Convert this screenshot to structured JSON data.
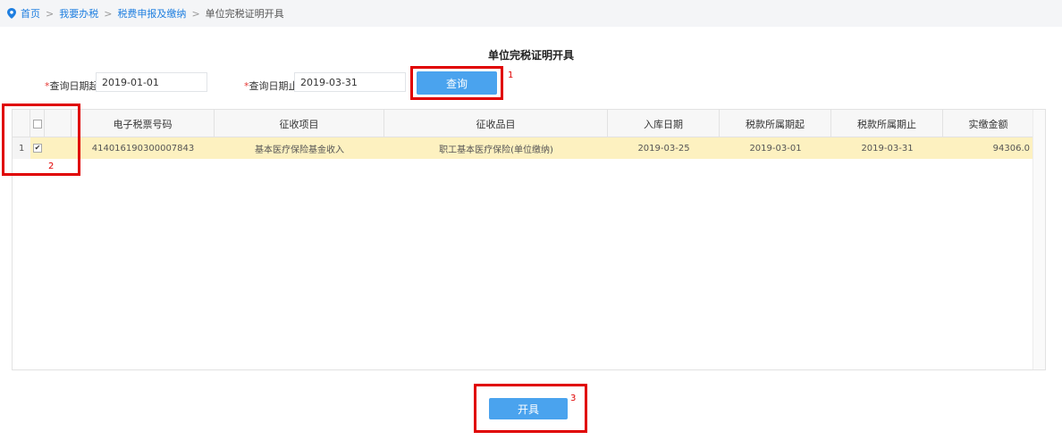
{
  "breadcrumb": {
    "items": [
      "首页",
      "我要办税",
      "税费申报及缴纳"
    ],
    "separator": ">",
    "current": "单位完税证明开具"
  },
  "page_title": "单位完税证明开具",
  "query": {
    "start_label": "查询日期起:",
    "start_value": "2019-01-01",
    "end_label": "查询日期止:",
    "end_value": "2019-03-31",
    "required_mark": "*",
    "button": "查询"
  },
  "table": {
    "columns": [
      "电子税票号码",
      "征收项目",
      "征收品目",
      "入库日期",
      "税款所属期起",
      "税款所属期止",
      "实缴金额"
    ],
    "rows": [
      {
        "row_no": "1",
        "checked": "✔",
        "cells": [
          "414016190300007843",
          "基本医疗保险基金收入",
          "职工基本医疗保险(单位缴纳)",
          "2019-03-25",
          "2019-03-01",
          "2019-03-31",
          "94306.0"
        ]
      }
    ]
  },
  "issue_button": "开具",
  "annotations": [
    "1",
    "2",
    "3"
  ],
  "colors": {
    "accent": "#4aa3ee",
    "highlight": "#e00000",
    "selected_row": "#fdf1c0",
    "link": "#1f7fe0"
  }
}
